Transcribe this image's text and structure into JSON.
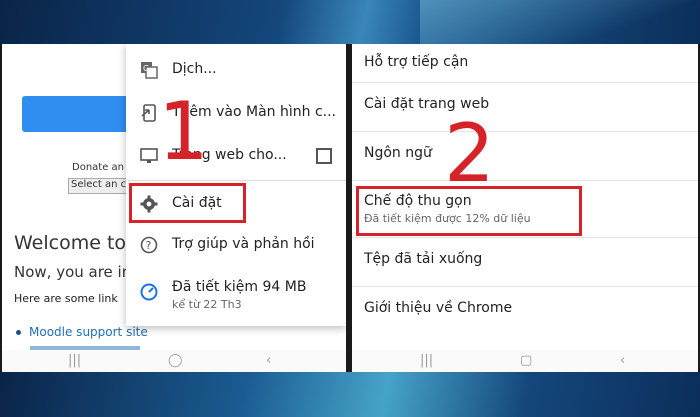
{
  "left": {
    "page": {
      "donate_text": "Donate an",
      "select_text": "Select an c",
      "welcome": "Welcome to",
      "now_you": "Now, you are in",
      "here_are": "Here are some link",
      "moodle_link": "Moodle support site"
    },
    "menu": {
      "translate": "Dịch...",
      "add_home": "Thêm vào Màn hình c...",
      "desktop_site": "Trang web cho...",
      "settings": "Cài đặt",
      "help": "Trợ giúp và phản hồi",
      "saved_title": "Đã tiết kiệm 94 MB",
      "saved_sub": "kể từ 22 Th3"
    },
    "step": "1"
  },
  "right": {
    "items": {
      "accessibility": "Hỗ trợ tiếp cận",
      "site_settings": "Cài đặt trang web",
      "language": "Ngôn ngữ",
      "lite_mode": "Chế độ thu gọn",
      "lite_mode_sub": "Đã tiết kiệm được 12% dữ liệu",
      "downloads": "Tệp đã tải xuống",
      "about": "Giới thiệu về Chrome"
    },
    "step": "2"
  },
  "colors": {
    "highlight": "#d6232a",
    "accent": "#2f8ef0"
  },
  "icons": [
    "translate-icon",
    "add-to-home-icon",
    "desktop-icon",
    "gear-icon",
    "help-icon",
    "savings-icon"
  ]
}
